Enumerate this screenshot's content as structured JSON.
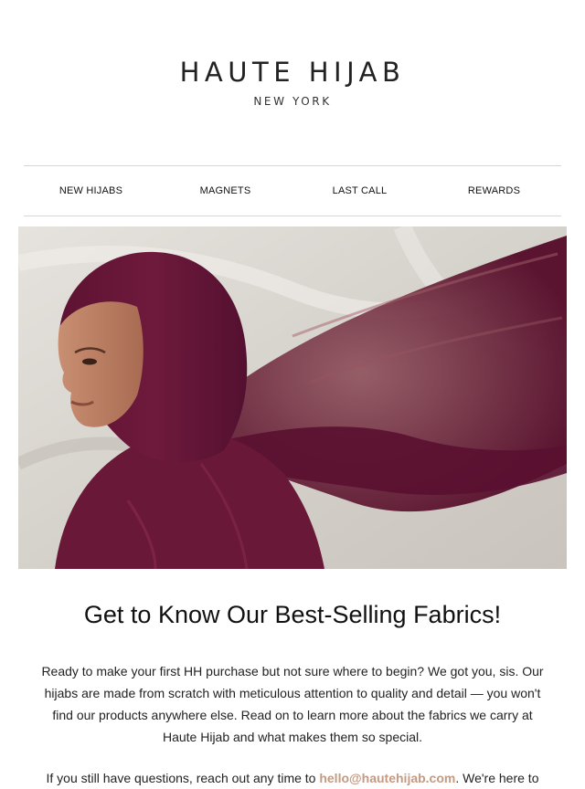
{
  "brand": {
    "name": "HAUTE HIJAB",
    "location": "NEW YORK"
  },
  "nav": {
    "items": [
      {
        "label": "NEW HIJABS"
      },
      {
        "label": "MAGNETS"
      },
      {
        "label": "LAST CALL"
      },
      {
        "label": "REWARDS"
      }
    ]
  },
  "hero": {
    "image": "woman-in-plum-hijab-with-flowing-fabric",
    "colors": {
      "fabric": "#6b1838",
      "background": "#dcd9d3"
    }
  },
  "main": {
    "headline": "Get to Know Our Best-Selling Fabrics!",
    "intro": "Ready to make your first HH purchase but not sure where to begin? We got you, sis. Our hijabs are made from scratch with meticulous attention to quality and detail — you won't find our products anywhere else. Read on to learn more about the fabrics we carry at Haute Hijab and what makes them so special.",
    "contact_prefix": "If you still have questions, reach out any time to ",
    "contact_email": "hello@hautehijab.com",
    "contact_suffix": ". We're here to"
  },
  "colors": {
    "link": "#c49a82",
    "divider": "#d7d7d7",
    "text": "#222222"
  }
}
